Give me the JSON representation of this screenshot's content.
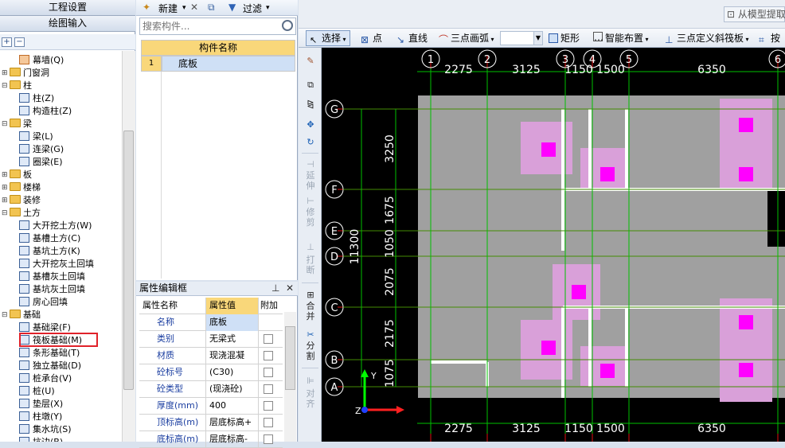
{
  "nav": {
    "project_settings": "工程设置",
    "drawing_input": "绘图输入"
  },
  "tree": [
    {
      "label": "幕墙(Q)",
      "kind": "item",
      "icon": "curtain-wall-icon"
    },
    {
      "label": "门窗洞",
      "kind": "folder",
      "state": "collapsed"
    },
    {
      "label": "柱",
      "kind": "folder",
      "state": "expanded"
    },
    {
      "label": "柱(Z)",
      "kind": "item",
      "icon": "column-icon"
    },
    {
      "label": "构造柱(Z)",
      "kind": "item",
      "icon": "constructional-column-icon"
    },
    {
      "label": "梁",
      "kind": "folder",
      "state": "expanded"
    },
    {
      "label": "梁(L)",
      "kind": "item",
      "icon": "beam-icon"
    },
    {
      "label": "连梁(G)",
      "kind": "item",
      "icon": "coupling-beam-icon"
    },
    {
      "label": "圈梁(E)",
      "kind": "item",
      "icon": "ring-beam-icon"
    },
    {
      "label": "板",
      "kind": "folder",
      "state": "collapsed"
    },
    {
      "label": "楼梯",
      "kind": "folder",
      "state": "collapsed"
    },
    {
      "label": "装修",
      "kind": "folder",
      "state": "collapsed"
    },
    {
      "label": "土方",
      "kind": "folder",
      "state": "expanded"
    },
    {
      "label": "大开挖土方(W)",
      "kind": "item",
      "icon": "excavation-icon"
    },
    {
      "label": "基槽土方(C)",
      "kind": "item",
      "icon": "trench-icon"
    },
    {
      "label": "基坑土方(K)",
      "kind": "item",
      "icon": "pit-icon"
    },
    {
      "label": "大开挖灰土回填",
      "kind": "item",
      "icon": "backfill-icon"
    },
    {
      "label": "基槽灰土回填",
      "kind": "item",
      "icon": "trench-backfill-icon"
    },
    {
      "label": "基坑灰土回填",
      "kind": "item",
      "icon": "pit-backfill-icon"
    },
    {
      "label": "房心回填",
      "kind": "item",
      "icon": "room-backfill-icon"
    },
    {
      "label": "基础",
      "kind": "folder",
      "state": "expanded"
    },
    {
      "label": "基础梁(F)",
      "kind": "item",
      "icon": "foundation-beam-icon"
    },
    {
      "label": "筏板基础(M)",
      "kind": "item",
      "icon": "raft-foundation-icon",
      "selected": true
    },
    {
      "label": "条形基础(T)",
      "kind": "item",
      "icon": "strip-foundation-icon"
    },
    {
      "label": "独立基础(D)",
      "kind": "item",
      "icon": "isolated-foundation-icon"
    },
    {
      "label": "桩承台(V)",
      "kind": "item",
      "icon": "pile-cap-icon"
    },
    {
      "label": "桩(U)",
      "kind": "item",
      "icon": "pile-icon"
    },
    {
      "label": "垫层(X)",
      "kind": "item",
      "icon": "cushion-icon"
    },
    {
      "label": "柱墩(Y)",
      "kind": "item",
      "icon": "column-pier-icon"
    },
    {
      "label": "集水坑(S)",
      "kind": "item",
      "icon": "sump-icon"
    },
    {
      "label": "坑边(B)",
      "kind": "item",
      "icon": "pit-edge-icon"
    }
  ],
  "component_list": {
    "new_label": "新建",
    "filter_label": "过滤",
    "search_placeholder": "搜索构件...",
    "column_header": "构件名称",
    "rows": [
      {
        "index": "1",
        "name": "底板"
      }
    ]
  },
  "properties": {
    "title": "属性编辑框",
    "headers": {
      "name": "属性名称",
      "value": "属性值",
      "extra": "附加"
    },
    "rows": [
      {
        "name": "名称",
        "value": "底板"
      },
      {
        "name": "类别",
        "value": "无梁式"
      },
      {
        "name": "材质",
        "value": "现浇混凝"
      },
      {
        "name": "砼标号",
        "value": "(C30)"
      },
      {
        "name": "砼类型",
        "value": "(现浇砼)"
      },
      {
        "name": "厚度(mm)",
        "value": "400"
      },
      {
        "name": "顶标高(m)",
        "value": "层底标高+"
      },
      {
        "name": "底标高(m)",
        "value": "层底标高-"
      }
    ]
  },
  "toolbar": {
    "select": "选择",
    "point": "点",
    "line": "直线",
    "arc": "三点画弧",
    "rect": "矩形",
    "smart_layout": "智能布置",
    "slope": "三点定义斜筏板",
    "by": "按",
    "model_extract": "从模型提取"
  },
  "side_tools": {
    "extend": "延伸",
    "trim": "修剪",
    "break": "打断",
    "merge": "合并",
    "split": "分割",
    "align": "对齐"
  },
  "canvas": {
    "axes_x": [
      "1",
      "2",
      "3",
      "4",
      "5",
      "6"
    ],
    "axes_y": [
      "G",
      "F",
      "E",
      "D",
      "C",
      "B",
      "A"
    ],
    "dims_top": [
      "2275",
      "3125",
      "1150",
      "1500",
      "6350"
    ],
    "dims_left": [
      "3250",
      "1675",
      "1050",
      "2075",
      "2175",
      "1075"
    ],
    "total_dim": "11300",
    "ucs": {
      "y": "Y",
      "z": "Z"
    },
    "colors": {
      "background": "#000000",
      "slab": "#a0a0a0",
      "cap": "#d9a0d9",
      "pier": "#ff00ff",
      "grid": "#e01010",
      "axis": "#00c000"
    }
  }
}
